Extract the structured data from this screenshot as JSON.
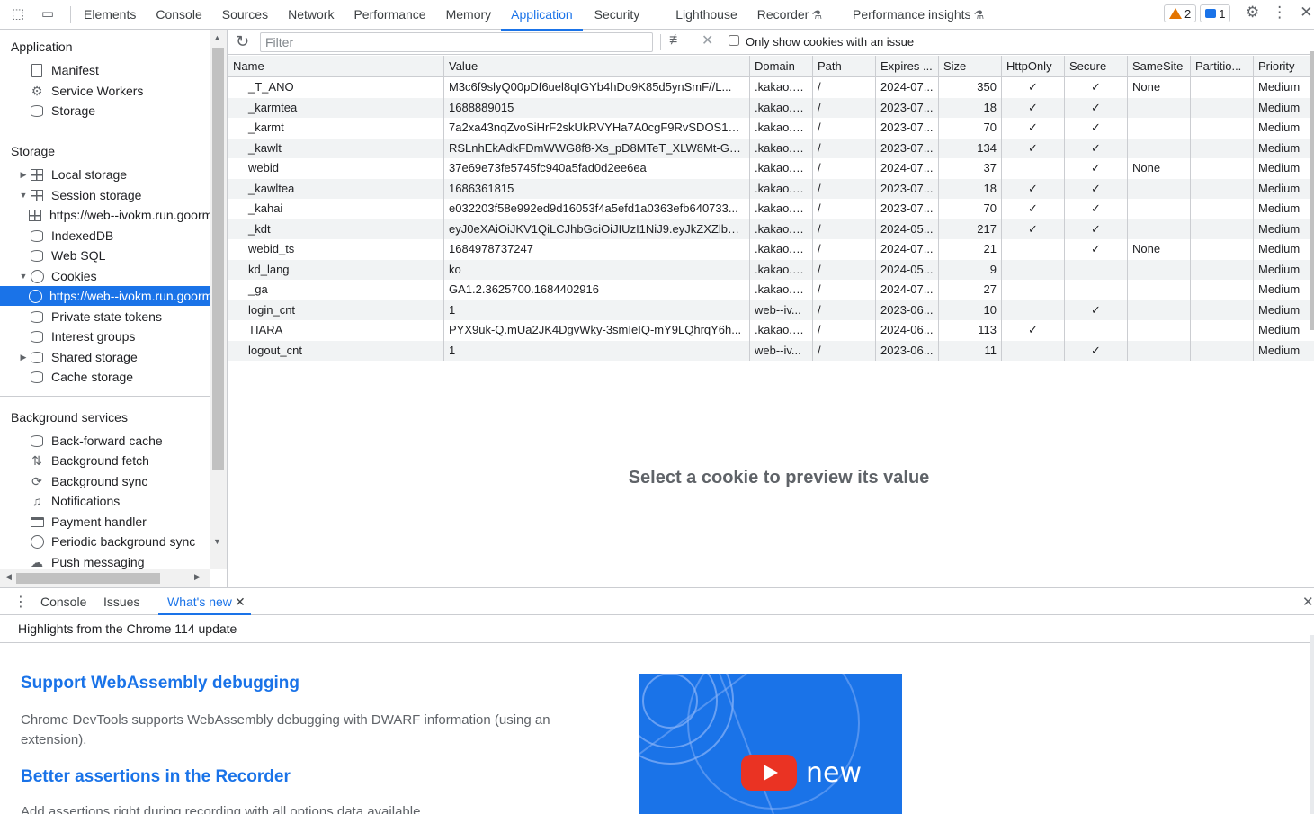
{
  "topbar": {
    "tabs": [
      "Elements",
      "Console",
      "Sources",
      "Network",
      "Performance",
      "Memory",
      "Application",
      "Security",
      "Lighthouse",
      "Recorder",
      "Performance insights"
    ],
    "active_tab": "Application",
    "warnings_count": "2",
    "messages_count": "1"
  },
  "sidebar": {
    "application_title": "Application",
    "application_items": [
      "Manifest",
      "Service Workers",
      "Storage"
    ],
    "storage_title": "Storage",
    "storage_items": [
      "Local storage",
      "Session storage",
      "https://web--ivokm.run.goorm.site",
      "IndexedDB",
      "Web SQL",
      "Cookies",
      "https://web--ivokm.run.goorm.site",
      "Private state tokens",
      "Interest groups",
      "Shared storage",
      "Cache storage"
    ],
    "background_title": "Background services",
    "background_items": [
      "Back-forward cache",
      "Background fetch",
      "Background sync",
      "Notifications",
      "Payment handler",
      "Periodic background sync",
      "Push messaging"
    ]
  },
  "toolbar": {
    "filter_placeholder": "Filter",
    "only_issues_label": "Only show cookies with an issue"
  },
  "cookies": {
    "columns": [
      "Name",
      "Value",
      "Domain",
      "Path",
      "Expires ...",
      "Size",
      "HttpOnly",
      "Secure",
      "SameSite",
      "Partitio...",
      "Priority"
    ],
    "rows": [
      [
        "_T_ANO",
        "M3c6f9slyQ00pDf6uel8qIGYb4hDo9K85d5ynSmF//L...",
        ".kakao.c...",
        "/",
        "2024-07...",
        "350",
        "✓",
        "✓",
        "None",
        "",
        "Medium"
      ],
      [
        "_karmtea",
        "1688889015",
        ".kakao.c...",
        "/",
        "2023-07...",
        "18",
        "✓",
        "✓",
        "",
        "",
        "Medium"
      ],
      [
        "_karmt",
        "7a2xa43nqZvoSiHrF2skUkRVYHa7A0cgF9RvSDOS1al...",
        ".kakao.c...",
        "/",
        "2023-07...",
        "70",
        "✓",
        "✓",
        "",
        "",
        "Medium"
      ],
      [
        "_kawlt",
        "RSLnhEkAdkFDmWWG8f8-Xs_pD8MTeT_XLW8Mt-G1...",
        ".kakao.c...",
        "/",
        "2023-07...",
        "134",
        "✓",
        "✓",
        "",
        "",
        "Medium"
      ],
      [
        "webid",
        "37e69e73fe5745fc940a5fad0d2ee6ea",
        ".kakao.c...",
        "/",
        "2024-07...",
        "37",
        "",
        "✓",
        "None",
        "",
        "Medium"
      ],
      [
        "_kawltea",
        "1686361815",
        ".kakao.c...",
        "/",
        "2023-07...",
        "18",
        "✓",
        "✓",
        "",
        "",
        "Medium"
      ],
      [
        "_kahai",
        "e032203f58e992ed9d16053f4a5efd1a0363efb640733...",
        ".kakao.c...",
        "/",
        "2023-07...",
        "70",
        "✓",
        "✓",
        "",
        "",
        "Medium"
      ],
      [
        "_kdt",
        "eyJ0eXAiOiJKV1QiLCJhbGciOiJIUzI1NiJ9.eyJkZXZlbG9...",
        ".kakao.c...",
        "/",
        "2024-05...",
        "217",
        "✓",
        "✓",
        "",
        "",
        "Medium"
      ],
      [
        "webid_ts",
        "1684978737247",
        ".kakao.c...",
        "/",
        "2024-07...",
        "21",
        "",
        "✓",
        "None",
        "",
        "Medium"
      ],
      [
        "kd_lang",
        "ko",
        ".kakao.c...",
        "/",
        "2024-05...",
        "9",
        "",
        "",
        "",
        "",
        "Medium"
      ],
      [
        "_ga",
        "GA1.2.3625700.1684402916",
        ".kakao.c...",
        "/",
        "2024-07...",
        "27",
        "",
        "",
        "",
        "",
        "Medium"
      ],
      [
        "login_cnt",
        "1",
        "web--iv...",
        "/",
        "2023-06...",
        "10",
        "",
        "✓",
        "",
        "",
        "Medium"
      ],
      [
        "TIARA",
        "PYX9uk-Q.mUa2JK4DgvWky-3smIeIQ-mY9LQhrqY6h...",
        ".kakao.c...",
        "/",
        "2024-06...",
        "113",
        "✓",
        "",
        "",
        "",
        "Medium"
      ],
      [
        "logout_cnt",
        "1",
        "web--iv...",
        "/",
        "2023-06...",
        "11",
        "",
        "✓",
        "",
        "",
        "Medium"
      ]
    ],
    "preview_message": "Select a cookie to preview its value"
  },
  "drawer": {
    "tabs": [
      "Console",
      "Issues",
      "What's new"
    ],
    "active_tab": "What's new",
    "highlights": "Highlights from the Chrome 114 update",
    "features": [
      {
        "title": "Support WebAssembly debugging",
        "body": "Chrome DevTools supports WebAssembly debugging with DWARF information (using an extension)."
      },
      {
        "title": "Better assertions in the Recorder",
        "body": "Add assertions right during recording with all options data available ..."
      }
    ],
    "video_caption": "new"
  },
  "colors": {
    "accent": "#1a73e8",
    "warning": "#e37400",
    "play_red": "#ea3323"
  }
}
